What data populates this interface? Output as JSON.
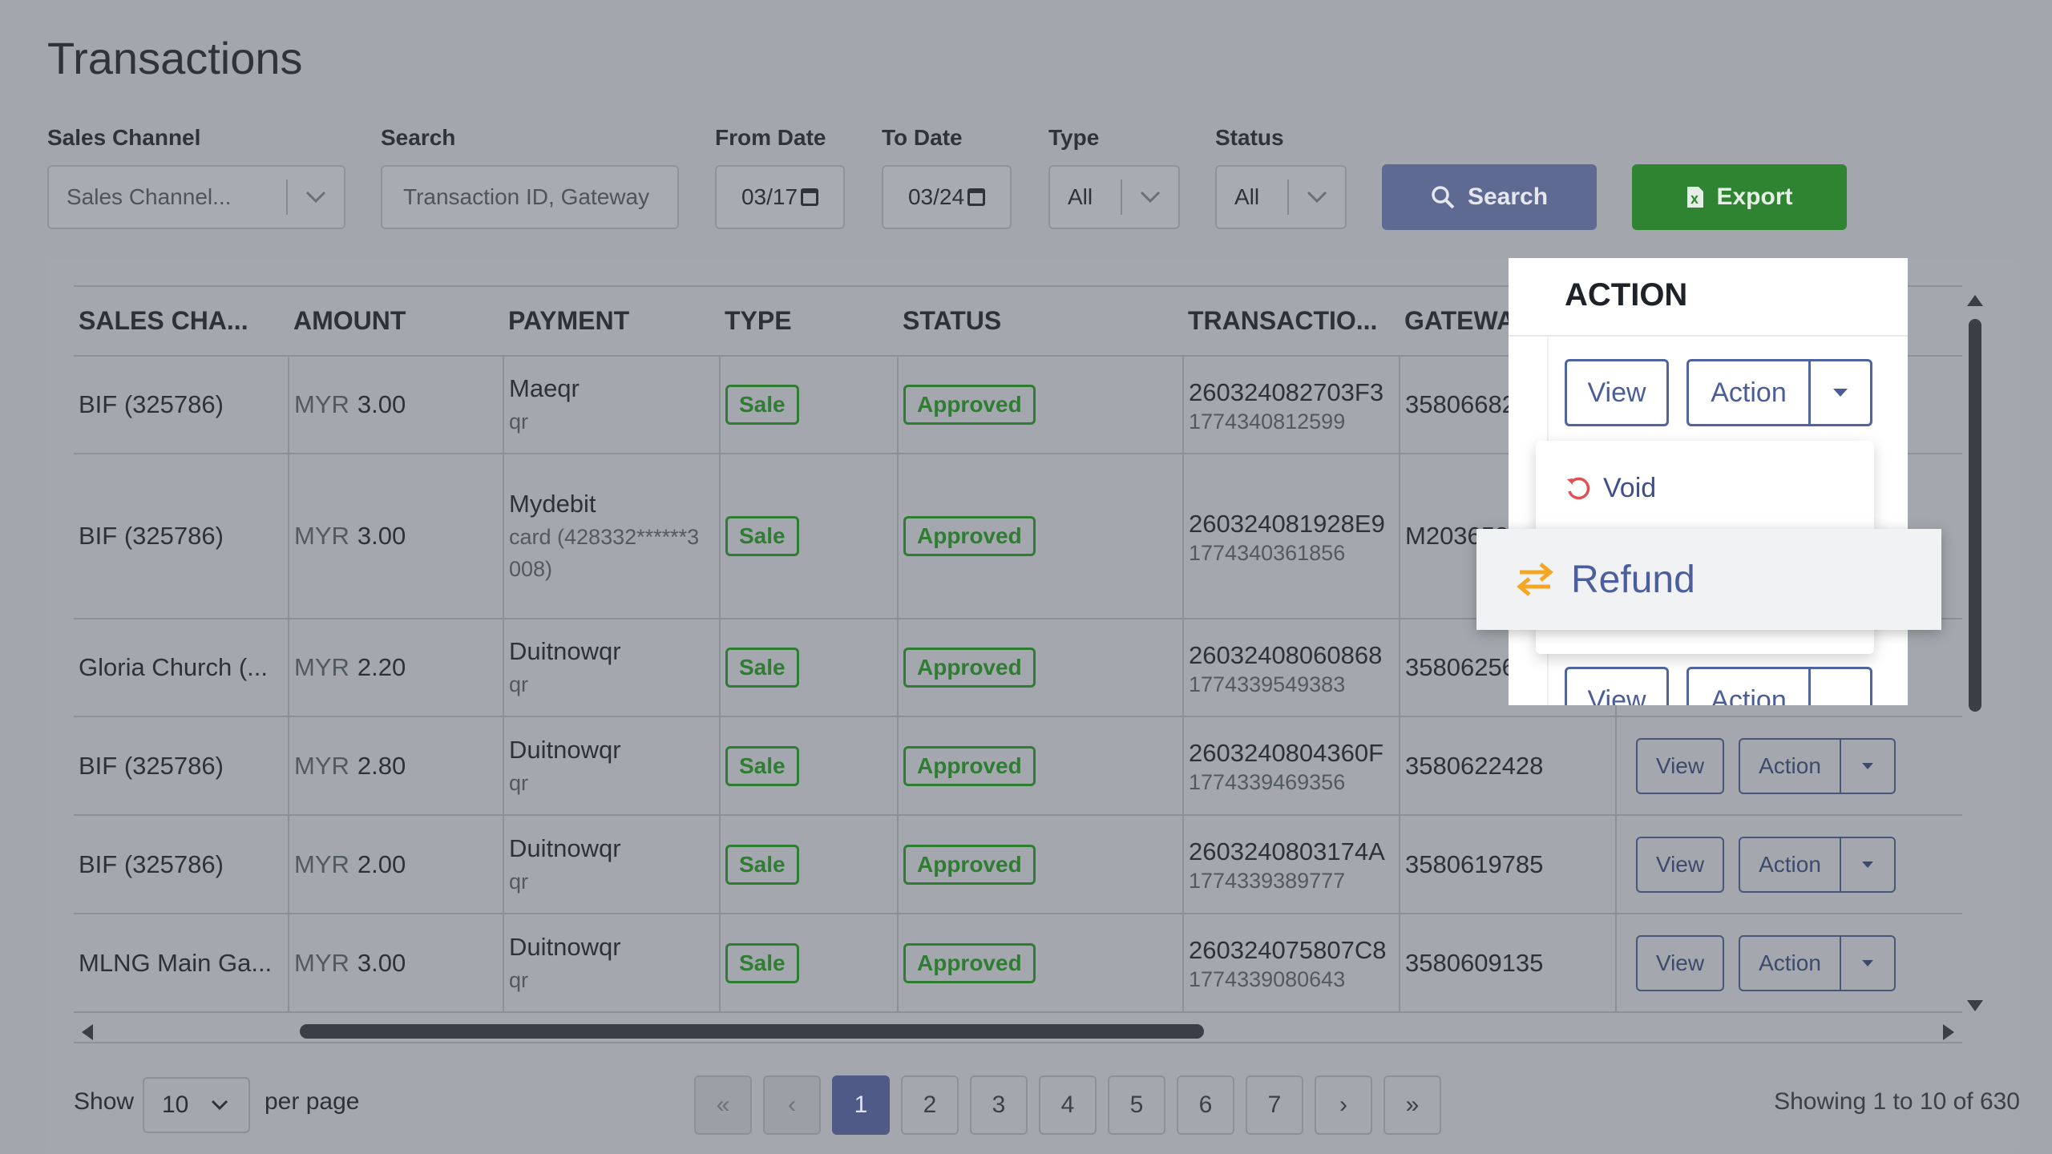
{
  "page": {
    "title": "Transactions"
  },
  "filters": {
    "sales_channel": {
      "label": "Sales Channel",
      "placeholder": "Sales Channel..."
    },
    "search": {
      "label": "Search",
      "placeholder": "Transaction ID, Gateway"
    },
    "from_date": {
      "label": "From Date",
      "value": "03/17"
    },
    "to_date": {
      "label": "To Date",
      "value": "03/24"
    },
    "type": {
      "label": "Type",
      "value": "All"
    },
    "status": {
      "label": "Status",
      "value": "All"
    },
    "search_button": "Search",
    "export_button": "Export"
  },
  "table": {
    "columns": [
      "SALES CHA...",
      "AMOUNT",
      "PAYMENT",
      "TYPE",
      "STATUS",
      "TRANSACTIO...",
      "GATEWAY"
    ],
    "rows": [
      {
        "channel": "BIF (325786)",
        "currency": "MYR",
        "amount": "3.00",
        "pay_main": "Maeqr",
        "pay_sub": "qr",
        "type": "Sale",
        "status": "Approved",
        "txn": "260324082703F3",
        "txn_sub": "1774340812599",
        "gateway": "3580668215"
      },
      {
        "channel": "BIF (325786)",
        "currency": "MYR",
        "amount": "3.00",
        "pay_main": "Mydebit",
        "pay_sub": "card (428332******3008)",
        "type": "Sale",
        "status": "Approved",
        "txn": "260324081928E9",
        "txn_sub": "1774340361856",
        "gateway": "M203658"
      },
      {
        "channel": "Gloria Church (...",
        "currency": "MYR",
        "amount": "2.20",
        "pay_main": "Duitnowqr",
        "pay_sub": "qr",
        "type": "Sale",
        "status": "Approved",
        "txn": "26032408060868",
        "txn_sub": "1774339549383",
        "gateway": "3580625601"
      },
      {
        "channel": "BIF (325786)",
        "currency": "MYR",
        "amount": "2.80",
        "pay_main": "Duitnowqr",
        "pay_sub": "qr",
        "type": "Sale",
        "status": "Approved",
        "txn": "2603240804360F",
        "txn_sub": "1774339469356",
        "gateway": "3580622428"
      },
      {
        "channel": "BIF (325786)",
        "currency": "MYR",
        "amount": "2.00",
        "pay_main": "Duitnowqr",
        "pay_sub": "qr",
        "type": "Sale",
        "status": "Approved",
        "txn": "2603240803174A",
        "txn_sub": "1774339389777",
        "gateway": "3580619785"
      },
      {
        "channel": "MLNG Main Ga...",
        "currency": "MYR",
        "amount": "3.00",
        "pay_main": "Duitnowqr",
        "pay_sub": "qr",
        "type": "Sale",
        "status": "Approved",
        "txn": "260324075807C8",
        "txn_sub": "1774339080643",
        "gateway": "3580609135"
      }
    ],
    "view_label": "View",
    "action_label": "Action"
  },
  "popover": {
    "title": "ACTION",
    "view_label": "View",
    "action_label": "Action",
    "menu": {
      "void": "Void",
      "refund": "Refund"
    }
  },
  "footer": {
    "show_label": "Show",
    "per_page_value": "10",
    "per_page_label": "per page",
    "pages": [
      "«",
      "‹",
      "1",
      "2",
      "3",
      "4",
      "5",
      "6",
      "7",
      "›",
      "»"
    ],
    "active_page": "1",
    "showing_text": "Showing 1 to 10 of 630"
  },
  "colors": {
    "overlay_bg": "#a3a7ad",
    "search_button": "#5f6a93",
    "export_button": "#2f8431",
    "approved": "#2f7d33",
    "refund_icon": "#f5a623",
    "void_icon": "#e05252"
  }
}
